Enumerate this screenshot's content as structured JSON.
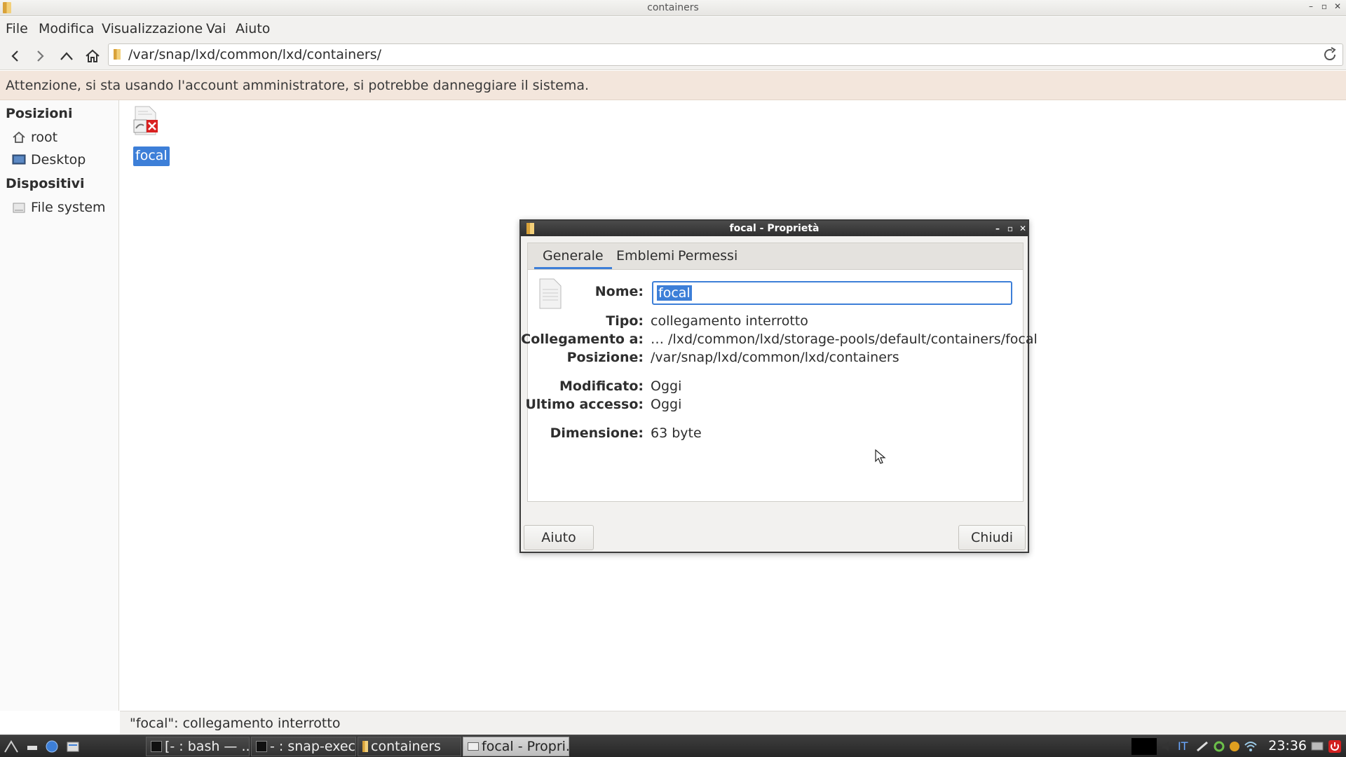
{
  "window": {
    "title": "containers"
  },
  "menu": [
    "File",
    "Modifica",
    "Visualizzazione",
    "Vai",
    "Aiuto"
  ],
  "location": {
    "path": "/var/snap/lxd/common/lxd/containers/"
  },
  "warning": "Attenzione, si sta usando l'account amministratore, si potrebbe danneggiare il sistema.",
  "sidebar": {
    "places_header": "Posizioni",
    "places": [
      {
        "label": "root",
        "icon": "home-icon"
      },
      {
        "label": "Desktop",
        "icon": "desktop-icon"
      }
    ],
    "devices_header": "Dispositivi",
    "devices": [
      {
        "label": "File system",
        "icon": "drive-icon"
      }
    ]
  },
  "files": [
    {
      "name": "focal",
      "icon": "broken-link-icon",
      "selected": true
    }
  ],
  "status": "\"focal\": collegamento interrotto",
  "taskbar": {
    "tasks": [
      {
        "label": "[- : bash — ...",
        "active": false
      },
      {
        "label": "- : snap-exec...",
        "active": false
      },
      {
        "label": "containers",
        "active": false
      },
      {
        "label": "focal - Propri...",
        "active": true
      }
    ],
    "keyboard_layout": "IT",
    "clock": "23:36"
  },
  "dialog": {
    "title": "focal - Proprietà",
    "tabs": [
      "Generale",
      "Emblemi",
      "Permessi"
    ],
    "active_tab": "Generale",
    "name_label": "Nome:",
    "name_value": "focal",
    "props": [
      {
        "label": "Tipo:",
        "value": "collegamento interrotto"
      },
      {
        "label": "Collegamento a:",
        "value": "… /lxd/common/lxd/storage-pools/default/containers/focal"
      },
      {
        "label": "Posizione:",
        "value": "/var/snap/lxd/common/lxd/containers"
      },
      {
        "label": "Modificato:",
        "value": "Oggi"
      },
      {
        "label": "Ultimo accesso:",
        "value": "Oggi"
      },
      {
        "label": "Dimensione:",
        "value": "63 byte"
      }
    ],
    "help_button": "Aiuto",
    "close_button": "Chiudi"
  }
}
